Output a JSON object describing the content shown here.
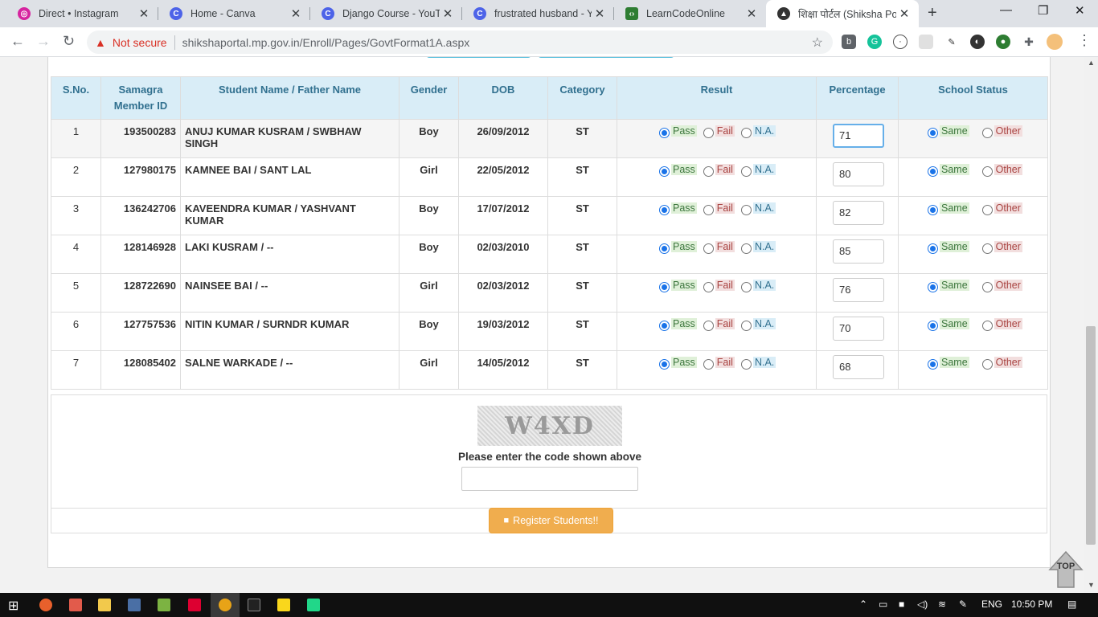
{
  "browser": {
    "tabs": [
      {
        "title": "Direct • Instagram",
        "icon": "instagram-icon",
        "color": "#d6249f"
      },
      {
        "title": "Home - Canva",
        "icon": "canva-icon",
        "color": "#4d63e8"
      },
      {
        "title": "Django Course - YouTube",
        "icon": "canva-icon",
        "color": "#4d63e8"
      },
      {
        "title": "frustrated husband - Yo",
        "icon": "canva-icon",
        "color": "#4d63e8"
      },
      {
        "title": "LearnCodeOnline",
        "icon": "lco-icon",
        "color": "#2e7d32"
      },
      {
        "title": "शिक्षा पोर्टल (Shiksha Port",
        "icon": "graduation-cap-icon",
        "color": "#333333"
      }
    ],
    "not_secure": "Not secure",
    "url": "shikshaportal.mp.gov.in/Enroll/Pages/GovtFormat1A.aspx"
  },
  "table": {
    "headers": {
      "sno": "S.No.",
      "samagra": "Samagra Member ID",
      "name": "Student Name / Father Name",
      "gender": "Gender",
      "dob": "DOB",
      "category": "Category",
      "result": "Result",
      "percentage": "Percentage",
      "status": "School Status"
    },
    "labels": {
      "pass": "Pass",
      "fail": "Fail",
      "na": "N.A.",
      "same": "Same",
      "other": "Other"
    },
    "rows": [
      {
        "sno": "1",
        "id": "193500283",
        "name": "ANUJ KUMAR KUSRAM / SWBHAW SINGH",
        "gender": "Boy",
        "dob": "26/09/2012",
        "category": "ST",
        "result": "Pass",
        "pct": "71",
        "status": "Same"
      },
      {
        "sno": "2",
        "id": "127980175",
        "name": "KAMNEE BAI / SANT LAL",
        "gender": "Girl",
        "dob": "22/05/2012",
        "category": "ST",
        "result": "Pass",
        "pct": "80",
        "status": "Same"
      },
      {
        "sno": "3",
        "id": "136242706",
        "name": "KAVEENDRA KUMAR / YASHVANT KUMAR",
        "gender": "Boy",
        "dob": "17/07/2012",
        "category": "ST",
        "result": "Pass",
        "pct": "82",
        "status": "Same"
      },
      {
        "sno": "4",
        "id": "128146928",
        "name": "LAKI KUSRAM / --",
        "gender": "Boy",
        "dob": "02/03/2010",
        "category": "ST",
        "result": "Pass",
        "pct": "85",
        "status": "Same"
      },
      {
        "sno": "5",
        "id": "128722690",
        "name": "NAINSEE BAI / --",
        "gender": "Girl",
        "dob": "02/03/2012",
        "category": "ST",
        "result": "Pass",
        "pct": "76",
        "status": "Same"
      },
      {
        "sno": "6",
        "id": "127757536",
        "name": "NITIN KUMAR / SURNDR KUMAR",
        "gender": "Boy",
        "dob": "19/03/2012",
        "category": "ST",
        "result": "Pass",
        "pct": "70",
        "status": "Same"
      },
      {
        "sno": "7",
        "id": "128085402",
        "name": "SALNE WARKADE / --",
        "gender": "Girl",
        "dob": "14/05/2012",
        "category": "ST",
        "result": "Pass",
        "pct": "68",
        "status": "Same"
      }
    ]
  },
  "captcha": {
    "code": "W4XD",
    "label": "Please enter the code shown above",
    "value": ""
  },
  "register_label": "Register Students!!",
  "top_label": "TOP",
  "taskbar": {
    "lang": "ENG",
    "time": "10:50 PM"
  }
}
